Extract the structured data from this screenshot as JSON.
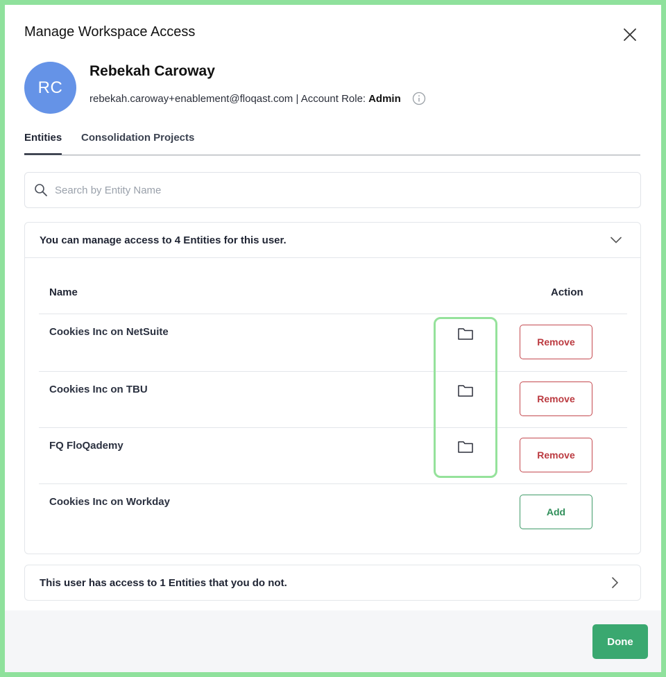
{
  "modal": {
    "title": "Manage Workspace Access",
    "close_icon": "close-icon"
  },
  "user": {
    "initials": "RC",
    "name": "Rebekah Caroway",
    "email_and_role_prefix": "rebekah.caroway+enablement@floqast.com | Account Role:",
    "role": "Admin",
    "avatar_color": "#6593e7"
  },
  "tabs": [
    {
      "label": "Entities",
      "active": true
    },
    {
      "label": "Consolidation Projects",
      "active": false
    }
  ],
  "search": {
    "placeholder": "Search by Entity Name",
    "value": ""
  },
  "managed_panel": {
    "header": "You can manage access to 4 Entities for this user.",
    "columns": {
      "name": "Name",
      "action": "Action"
    },
    "rows": [
      {
        "name": "Cookies Inc on NetSuite",
        "has_folder": true,
        "action": "Remove"
      },
      {
        "name": "Cookies Inc on TBU",
        "has_folder": true,
        "action": "Remove"
      },
      {
        "name": "FQ FloQademy",
        "has_folder": true,
        "action": "Remove"
      },
      {
        "name": "Cookies Inc on Workday",
        "has_folder": false,
        "action": "Add"
      }
    ]
  },
  "unmanaged_panel": {
    "header": "This user has access to 1 Entities that you do not."
  },
  "footer": {
    "done_label": "Done"
  },
  "colors": {
    "accent_green": "#3aa870",
    "remove_red": "#bb3a40",
    "highlight": "#95e29b"
  }
}
